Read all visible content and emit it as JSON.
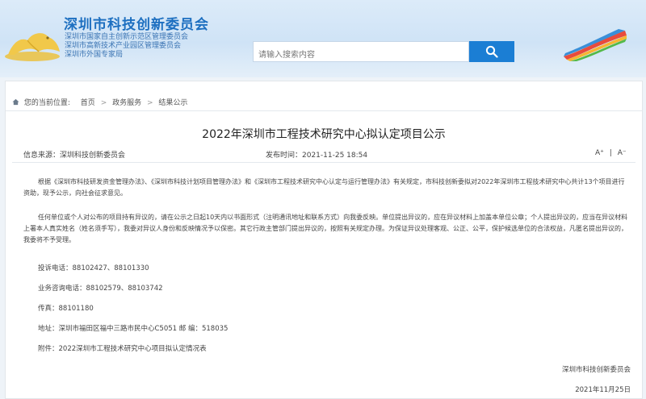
{
  "header": {
    "title": "深圳市科技创新委员会",
    "subtitles": [
      "深圳市国家自主创新示范区管理委员会",
      "深圳市高新技术产业园区管理委员会",
      "深圳市外国专家局"
    ],
    "search": {
      "placeholder": "请输入搜索内容"
    },
    "icons": {
      "logo": "pengcheng-logo",
      "search": "search-icon",
      "emblem": "rainbow-ribbon-logo"
    },
    "colors": {
      "brand": "#1d6fc0",
      "search_button": "#1b7ed4"
    }
  },
  "breadcrumb": {
    "label": "您的当前位置:",
    "items": [
      "首页",
      "政务服务",
      "结果公示"
    ],
    "separator": ">"
  },
  "article": {
    "title": "2022年深圳市工程技术研究中心拟认定项目公示",
    "source": "信息来源：深圳科技创新委员会",
    "published": "发布时间：2021-11-25 18:54",
    "font_larger": "A⁺",
    "font_sep": "|",
    "font_smaller": "A⁻",
    "paragraphs": [
      "根据《深圳市科技研发资金管理办法》、《深圳市科技计划项目管理办法》和《深圳市工程技术研究中心认定与运行管理办法》有关规定，市科技创新委拟对2022年深圳市工程技术研究中心共计13个项目进行资助，现予公示，向社会征求意见。",
      "任何单位或个人对公布的项目持有异议的，请在公示之日起10天内以书面形式（注明通讯地址和联系方式）向我委反映。单位提出异议的，应在异议材料上加盖本单位公章；个人提出异议的，应当在异议材料上署本人真实姓名（姓名须手写），我委对异议人身份和反映情况予以保密。其它行政主管部门提出异议的，按照有关规定办理。为保证异议处理客观、公正、公平，保护候选单位的合法权益，凡匿名提出异议的，我委将不予受理。"
    ],
    "contacts": [
      "投诉电话：88102427、88101330",
      "业务咨询电话：88102579、88103742",
      "传真：88101180",
      "地址：深圳市福田区福中三路市民中心C5051 邮 编：518035",
      "附件：2022深圳市工程技术研究中心项目拟认定情况表"
    ],
    "signature": "深圳市科技创新委员会",
    "date": "2021年11月25日"
  }
}
